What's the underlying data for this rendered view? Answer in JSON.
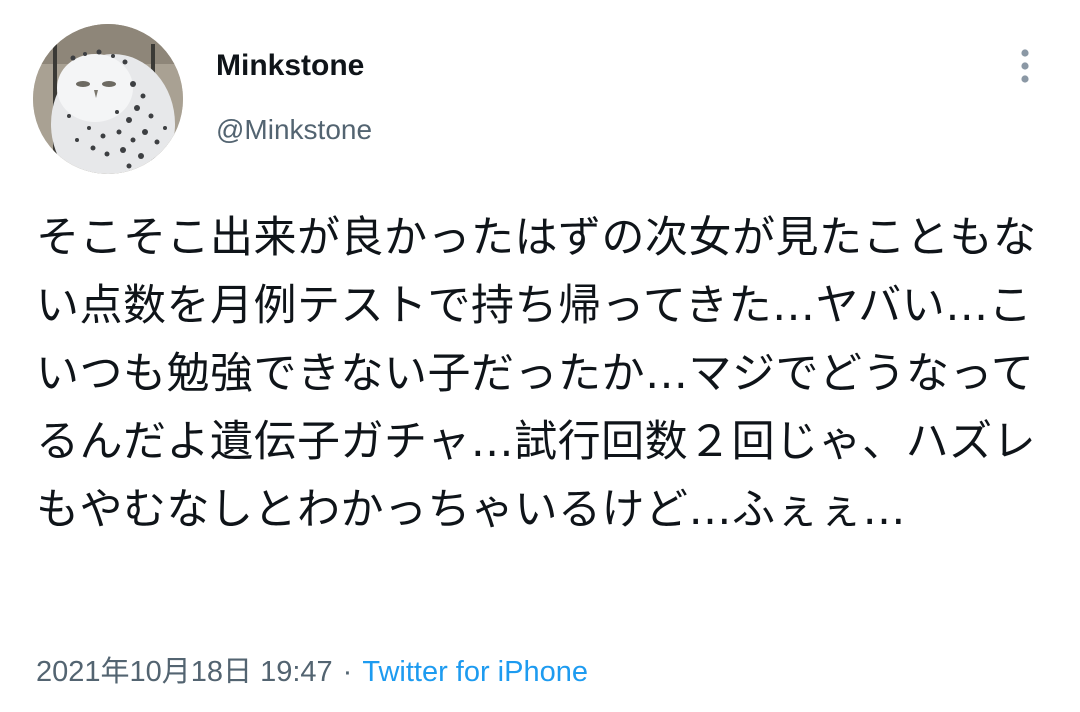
{
  "user": {
    "display_name": "Minkstone",
    "handle": "@Minkstone",
    "avatar_icon": "snowy-owl-avatar"
  },
  "menu": {
    "icon": "more-vertical-icon"
  },
  "tweet": {
    "text": "そこそこ出来が良かったはずの次女が見たこともない点数を月例テストで持ち帰ってきた…ヤバい…こいつも勉強できない子だったか…マジでどうなってるんだよ遺伝子ガチャ…試行回数２回じゃ、ハズレもやむなしとわかっちゃいるけど…ふぇぇ…",
    "timestamp": "2021年10月18日 19:47",
    "separator": "·",
    "source": "Twitter for iPhone"
  },
  "colors": {
    "text": "#0f1419",
    "secondary": "#536471",
    "link": "#1d9bf0",
    "background": "#ffffff"
  }
}
